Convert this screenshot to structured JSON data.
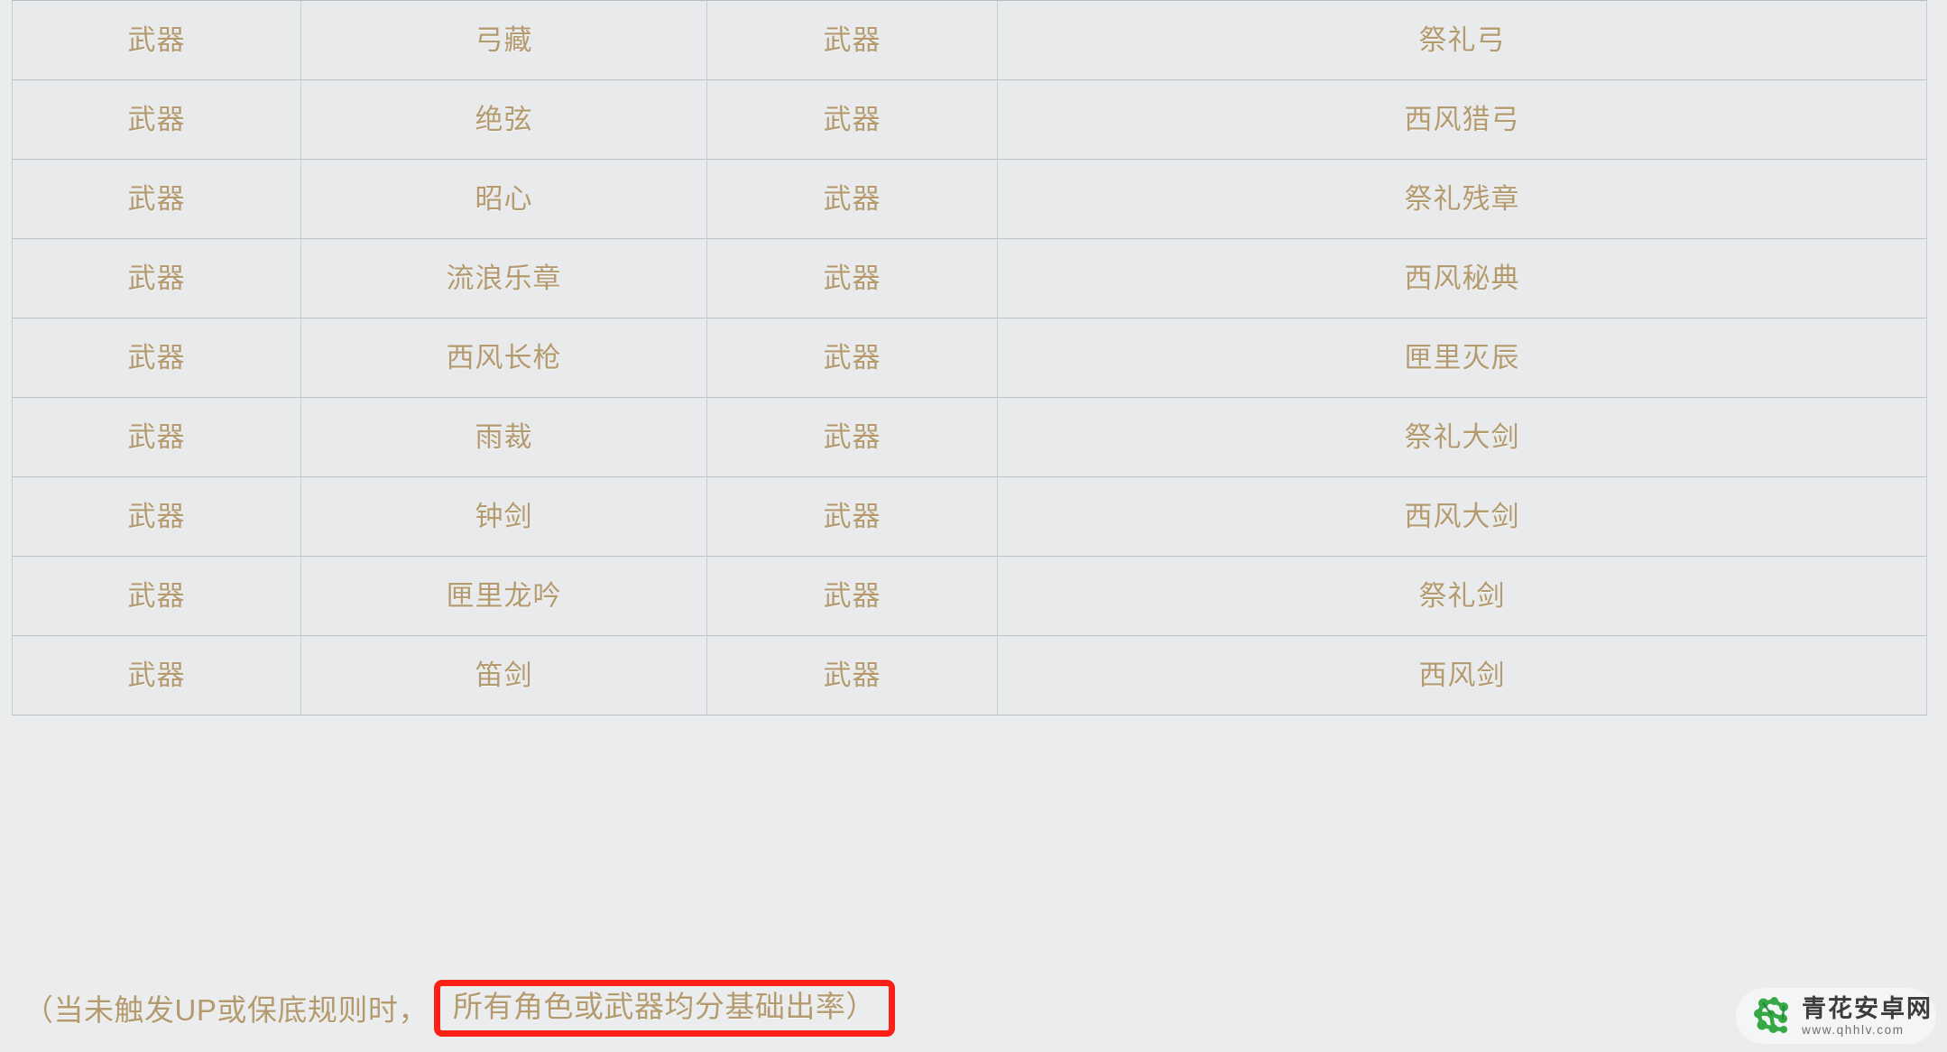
{
  "table": {
    "columns": 4,
    "rows": [
      {
        "c1": "武器",
        "c2": "弓藏",
        "c3": "武器",
        "c4": "祭礼弓"
      },
      {
        "c1": "武器",
        "c2": "绝弦",
        "c3": "武器",
        "c4": "西风猎弓"
      },
      {
        "c1": "武器",
        "c2": "昭心",
        "c3": "武器",
        "c4": "祭礼残章"
      },
      {
        "c1": "武器",
        "c2": "流浪乐章",
        "c3": "武器",
        "c4": "西风秘典"
      },
      {
        "c1": "武器",
        "c2": "西风长枪",
        "c3": "武器",
        "c4": "匣里灭辰"
      },
      {
        "c1": "武器",
        "c2": "雨裁",
        "c3": "武器",
        "c4": "祭礼大剑"
      },
      {
        "c1": "武器",
        "c2": "钟剑",
        "c3": "武器",
        "c4": "西风大剑"
      },
      {
        "c1": "武器",
        "c2": "匣里龙吟",
        "c3": "武器",
        "c4": "祭礼剑"
      },
      {
        "c1": "武器",
        "c2": "笛剑",
        "c3": "武器",
        "c4": "西风剑"
      }
    ]
  },
  "footer": {
    "plain_text": "（当未触发UP或保底规则时，",
    "highlight_text": "所有角色或武器均分基础出率）",
    "highlight_color": "#fc2117",
    "text_color": "#b49b6f"
  },
  "watermark": {
    "site_name": "青花安卓网",
    "site_url": "www.qhhlv.com",
    "logo_color": "#37a846",
    "logo_color_dark": "#1f8b3a"
  }
}
